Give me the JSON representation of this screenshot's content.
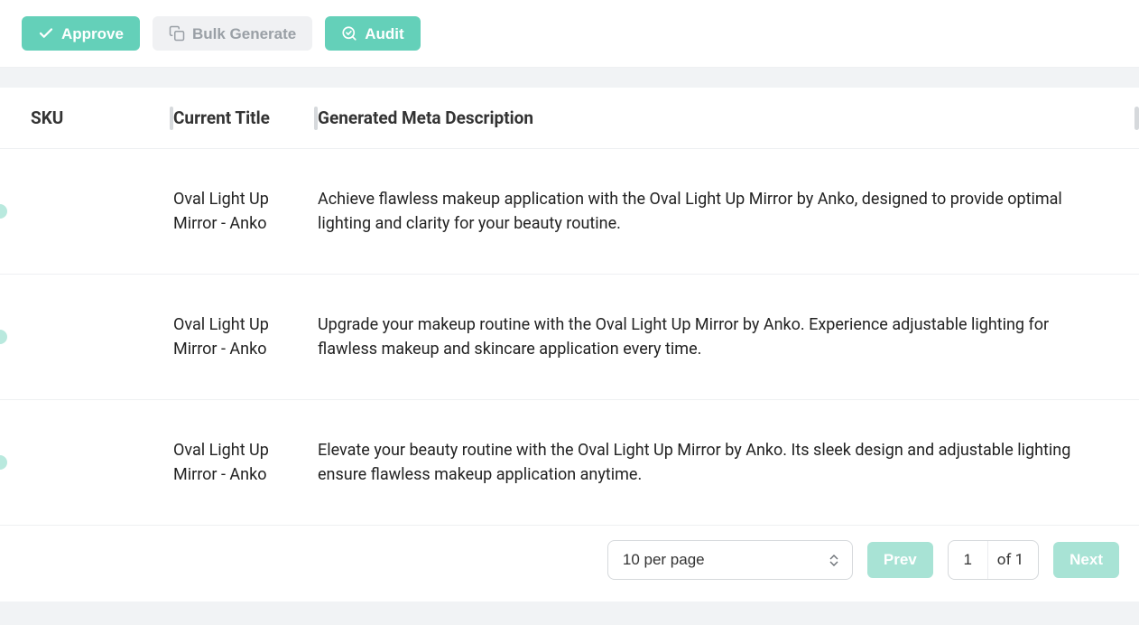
{
  "toolbar": {
    "approve_label": "Approve",
    "bulk_generate_label": "Bulk Generate",
    "audit_label": "Audit"
  },
  "table": {
    "headers": {
      "sku": "SKU",
      "title": "Current Title",
      "desc": "Generated Meta Description"
    },
    "rows": [
      {
        "sku": "",
        "title": "Oval Light Up Mirror - Anko",
        "desc": "Achieve flawless makeup application with the Oval Light Up Mirror by Anko, designed to provide optimal lighting and clarity for your beauty routine."
      },
      {
        "sku": "",
        "title": "Oval Light Up Mirror - Anko",
        "desc": "Upgrade your makeup routine with the Oval Light Up Mirror by Anko. Experience adjustable lighting for flawless makeup and skincare application every time."
      },
      {
        "sku": "",
        "title": "Oval Light Up Mirror - Anko",
        "desc": "Elevate your beauty routine with the Oval Light Up Mirror by Anko. Its sleek design and adjustable lighting ensure flawless makeup application anytime."
      }
    ]
  },
  "pagination": {
    "per_page_label": "10 per page",
    "prev_label": "Prev",
    "next_label": "Next",
    "current_page": "1",
    "total_pages_label": "of 1"
  }
}
